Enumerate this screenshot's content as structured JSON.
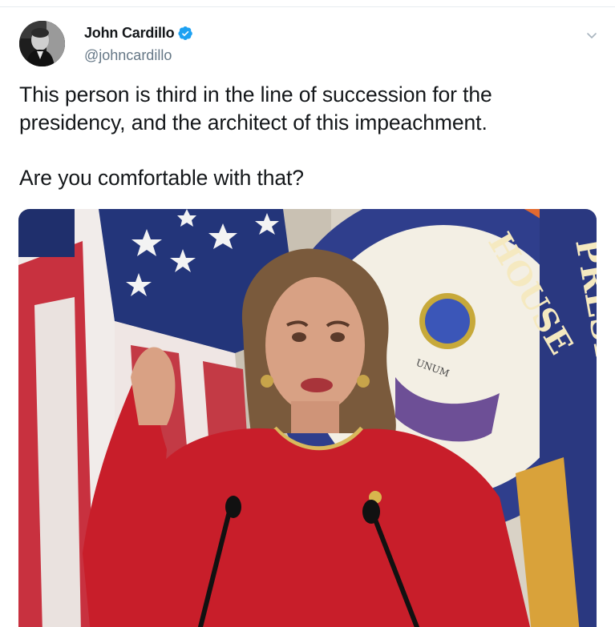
{
  "author": {
    "display_name": "John Cardillo",
    "handle": "@johncardillo",
    "verified": true,
    "avatar": "avatar-photo"
  },
  "tweet": {
    "text_line_1": "This person is third in the line of succession for the presidency, and the architect of this impeachment.",
    "text_line_2": "Are you comfortable with that?"
  },
  "media": {
    "kind": "video-still",
    "seal_text_visible": [
      "HOUSE",
      "PRESI",
      "UNUM"
    ]
  },
  "icons": {
    "verified": "verified-badge-icon",
    "menu": "chevron-down-icon"
  },
  "colors": {
    "verified_blue": "#1da1f2",
    "handle_gray": "#657786",
    "text": "#14171a"
  }
}
